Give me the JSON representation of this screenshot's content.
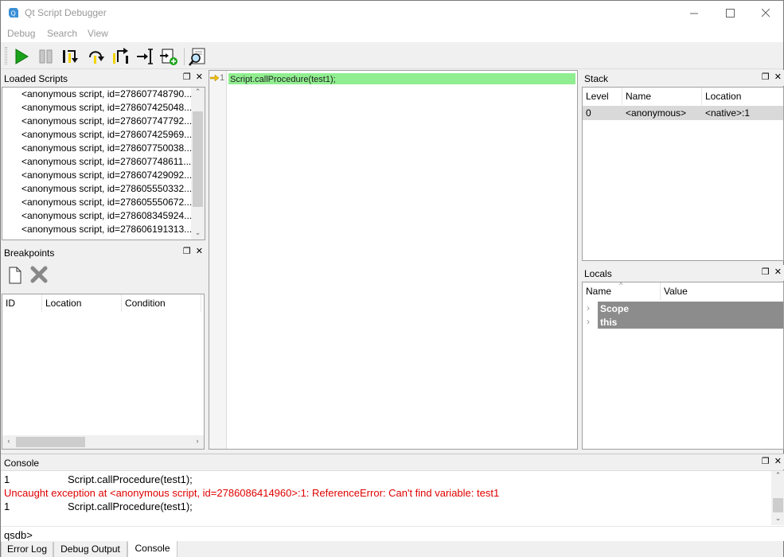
{
  "window": {
    "title": "Qt Script Debugger"
  },
  "menubar": {
    "items": [
      "Debug",
      "Search",
      "View"
    ]
  },
  "toolbar": {
    "buttons": [
      "continue",
      "interrupt",
      "step-into",
      "step-over",
      "step-out",
      "run-to-cursor",
      "run-to-new-script",
      "find"
    ]
  },
  "loaded_scripts": {
    "title": "Loaded Scripts",
    "items": [
      "<anonymous script, id=278607748790...",
      "<anonymous script, id=278607425048...",
      "<anonymous script, id=278607747792...",
      "<anonymous script, id=278607425969...",
      "<anonymous script, id=278607750038...",
      "<anonymous script, id=278607748611...",
      "<anonymous script, id=278607429092...",
      "<anonymous script, id=278605550332...",
      "<anonymous script, id=278605550672...",
      "<anonymous script, id=278608345924...",
      "<anonymous script, id=278606191313..."
    ]
  },
  "breakpoints": {
    "title": "Breakpoints",
    "columns": [
      "ID",
      "Location",
      "Condition"
    ]
  },
  "code": {
    "line_number": "1",
    "line_text": "Script.callProcedure(test1);"
  },
  "stack": {
    "title": "Stack",
    "columns": [
      "Level",
      "Name",
      "Location"
    ],
    "rows": [
      {
        "level": "0",
        "name": "<anonymous>",
        "location": "<native>:1"
      }
    ]
  },
  "locals": {
    "title": "Locals",
    "columns": [
      "Name",
      "Value"
    ],
    "rows": [
      "Scope",
      "this"
    ]
  },
  "console": {
    "title": "Console",
    "lines": [
      {
        "num": "1",
        "text": "Script.callProcedure(test1);"
      },
      {
        "error": "Uncaught exception at <anonymous script, id=2786086414960>:1: ReferenceError: Can't find variable: test1"
      },
      {
        "num": "1",
        "text": "Script.callProcedure(test1);"
      }
    ],
    "prompt": "qsdb>"
  },
  "tabs": [
    "Error Log",
    "Debug Output",
    "Console"
  ],
  "active_tab": "Console",
  "colors": {
    "current_line": "#90ee90",
    "error_text": "#e00000",
    "locals_row_bg": "#8c8c8c"
  }
}
